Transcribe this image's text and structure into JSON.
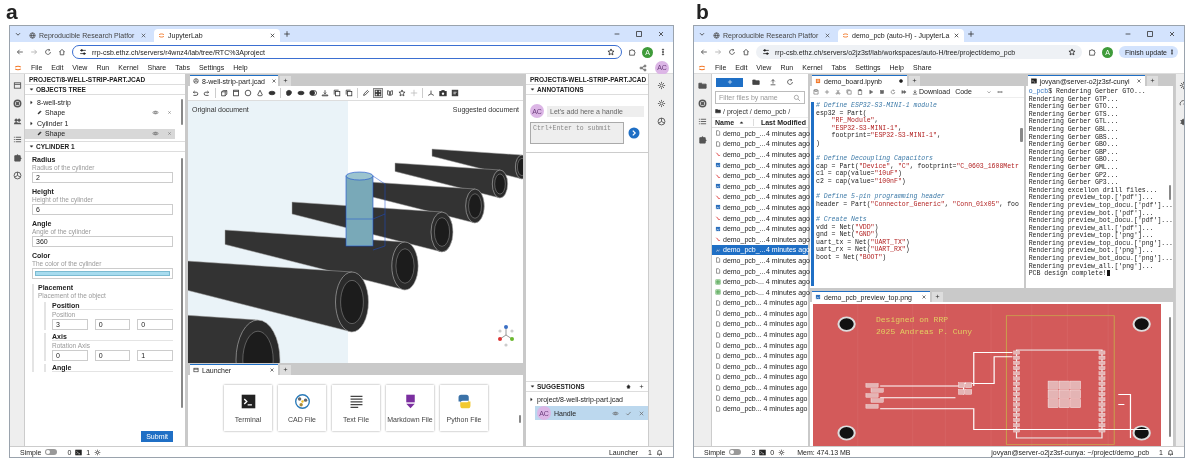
{
  "panel_a": {
    "label": "a",
    "browser": {
      "tabs": [
        {
          "title": "Reproducible Research Platfor",
          "selected": false
        },
        {
          "title": "JupyterLab",
          "selected": true
        }
      ],
      "url": "rrp-csb.ethz.ch/servers/r4wnz4/lab/tree/RTC%3Aproject",
      "url_focused": true,
      "profile": "A"
    },
    "menu": [
      "File",
      "Edit",
      "View",
      "Run",
      "Kernel",
      "Share",
      "Tabs",
      "Settings",
      "Help"
    ],
    "user_badge": "AC",
    "left_panel": {
      "title": "PROJECT/8-WELL-STRIP-PART.JCAD",
      "tree_section": "OBJECTS TREE",
      "tree": [
        {
          "label": "8-well-strip",
          "kind": "group",
          "selected": false
        },
        {
          "label": "Shape",
          "kind": "shape",
          "selected": false
        },
        {
          "label": "Cylinder 1",
          "kind": "group",
          "selected": false
        },
        {
          "label": "Shape",
          "kind": "shape",
          "selected": true
        }
      ],
      "form_section": "CYLINDER 1",
      "fields": [
        {
          "kind": "text",
          "label": "Radius",
          "description": "Radius of the cylinder",
          "value": "2"
        },
        {
          "kind": "text",
          "label": "Height",
          "description": "Height of the cylinder",
          "value": "6"
        },
        {
          "kind": "text",
          "label": "Angle",
          "description": "Angle of the cylinder",
          "value": "360"
        },
        {
          "kind": "color",
          "label": "Color",
          "description": "The color of the cylinder",
          "color": "#a8dcef"
        }
      ],
      "placement": {
        "label": "Placement",
        "description": "Placement of the object",
        "groups": [
          {
            "label": "Position",
            "description": "Position",
            "values": [
              "3",
              "0",
              "0"
            ]
          },
          {
            "label": "Axis",
            "description": "Rotation Axis",
            "values": [
              "0",
              "0",
              "1"
            ]
          },
          {
            "label": "Angle"
          }
        ]
      },
      "submit": "Submit"
    },
    "document": {
      "tab": "8-well-strip-part.jcad",
      "original_label": "Original document",
      "suggested_label": "Suggested document"
    },
    "launcher": {
      "tab": "Launcher",
      "items": [
        {
          "label": "Terminal",
          "kind": "terminal"
        },
        {
          "label": "CAD File",
          "kind": "cad"
        },
        {
          "label": "Text File",
          "kind": "text"
        },
        {
          "label": "Markdown File",
          "kind": "markdown"
        },
        {
          "label": "Python File",
          "kind": "python"
        }
      ]
    },
    "right_panel": {
      "title": "PROJECT/8-WELL-STRIP-PART.JCAD",
      "annotations_section": "ANNOTATIONS",
      "comment": {
        "author": "AC",
        "text": "Let's add here a handle"
      },
      "reply_placeholder": "Ctrl+Enter to submit",
      "suggestions_section": "SUGGESTIONS",
      "suggestions": [
        {
          "label": "project/8-well-strip-part.jcad",
          "children": [
            {
              "author": "AC",
              "label": "Handle",
              "selected": true
            }
          ]
        }
      ]
    },
    "status_bar": {
      "mode": "Simple",
      "simple_on": false,
      "terminals": "0",
      "kernels": "1",
      "right_text": "Launcher",
      "notifications": "1"
    }
  },
  "panel_b": {
    "label": "b",
    "browser": {
      "tabs": [
        {
          "title": "Reproducible Research Platfor",
          "selected": false
        },
        {
          "title": "demo_pcb (auto-H) - JupyterLa",
          "selected": true
        }
      ],
      "url": "rrp-csb.ethz.ch/servers/o2jz3sf/lab/workspaces/auto-H/tree/project/demo_pcb",
      "url_focused": false,
      "profile": "A",
      "update_button": "Finish update"
    },
    "menu": [
      "File",
      "Edit",
      "View",
      "Run",
      "Kernel",
      "Tabs",
      "Settings",
      "Help",
      "Share"
    ],
    "file_browser": {
      "filter_placeholder": "Filter files by name",
      "breadcrumb": "/ project / demo_pcb /",
      "name_header": "Name",
      "modified_header": "Last Modified",
      "files": [
        {
          "name": "demo_pcb_...",
          "kind": "file",
          "modified": "4 minutes ago",
          "selected": false
        },
        {
          "name": "demo_pcb_...",
          "kind": "file",
          "modified": "4 minutes ago",
          "selected": false
        },
        {
          "name": "demo_pcb_...",
          "kind": "pdf",
          "modified": "4 minutes ago",
          "selected": false
        },
        {
          "name": "demo_pcb_...",
          "kind": "image",
          "modified": "4 minutes ago",
          "selected": false
        },
        {
          "name": "demo_pcb_...",
          "kind": "pdf",
          "modified": "4 minutes ago",
          "selected": false
        },
        {
          "name": "demo_pcb_...",
          "kind": "image",
          "modified": "4 minutes ago",
          "selected": false
        },
        {
          "name": "demo_pcb_...",
          "kind": "pdf",
          "modified": "4 minutes ago",
          "selected": false
        },
        {
          "name": "demo_pcb_...",
          "kind": "image",
          "modified": "4 minutes ago",
          "selected": false
        },
        {
          "name": "demo_pcb_...",
          "kind": "pdf",
          "modified": "4 minutes ago",
          "selected": false
        },
        {
          "name": "demo_pcb_...",
          "kind": "image",
          "modified": "4 minutes ago",
          "selected": false
        },
        {
          "name": "demo_pcb_...",
          "kind": "pdf",
          "modified": "4 minutes ago",
          "selected": false
        },
        {
          "name": "demo_pcb_...",
          "kind": "image",
          "modified": "4 minutes ago",
          "selected": true
        },
        {
          "name": "demo_pcb_...",
          "kind": "file",
          "modified": "4 minutes ago",
          "selected": false
        },
        {
          "name": "demo_pcb_...",
          "kind": "file",
          "modified": "4 minutes ago",
          "selected": false
        },
        {
          "name": "demo_pcb-...",
          "kind": "table",
          "modified": "4 minutes ago",
          "selected": false
        },
        {
          "name": "demo_pcb-...",
          "kind": "table",
          "modified": "4 minutes ago",
          "selected": false
        },
        {
          "name": "demo_pcb...",
          "kind": "file",
          "modified": "4 minutes ago",
          "selected": false
        },
        {
          "name": "demo_pcb...",
          "kind": "file",
          "modified": "4 minutes ago",
          "selected": false
        },
        {
          "name": "demo_pcb...",
          "kind": "file",
          "modified": "4 minutes ago",
          "selected": false
        },
        {
          "name": "demo_pcb...",
          "kind": "file",
          "modified": "4 minutes ago",
          "selected": false
        },
        {
          "name": "demo_pcb...",
          "kind": "file",
          "modified": "4 minutes ago",
          "selected": false
        },
        {
          "name": "demo_pcb...",
          "kind": "file",
          "modified": "4 minutes ago",
          "selected": false
        },
        {
          "name": "demo_pcb...",
          "kind": "file",
          "modified": "4 minutes ago",
          "selected": false
        },
        {
          "name": "demo_pcb...",
          "kind": "file",
          "modified": "4 minutes ago",
          "selected": false
        },
        {
          "name": "demo_pcb...",
          "kind": "file",
          "modified": "4 minutes ago",
          "selected": false
        },
        {
          "name": "demo_pcb...",
          "kind": "file",
          "modified": "4 minutes ago",
          "selected": false
        },
        {
          "name": "demo_pcb...",
          "kind": "file",
          "modified": "4 minutes ago",
          "selected": false
        }
      ]
    },
    "notebook": {
      "tab": "demo_board.ipynb",
      "unsaved": true,
      "download": "Download",
      "cell_type": "Code",
      "lines": [
        {
          "parts": [
            {
              "kind": "comment",
              "text": "# Define ESP32-S3-MINI-1 module"
            }
          ]
        },
        {
          "parts": [
            {
              "kind": "plain",
              "text": "esp32 = Part("
            }
          ]
        },
        {
          "parts": [
            {
              "kind": "string",
              "text": "    \"RF_Module\""
            },
            {
              "kind": "plain",
              "text": ","
            }
          ]
        },
        {
          "parts": [
            {
              "kind": "string",
              "text": "    \"ESP32-S3-MINI-1\""
            },
            {
              "kind": "plain",
              "text": ","
            }
          ]
        },
        {
          "parts": [
            {
              "kind": "plain",
              "text": "    footprint="
            },
            {
              "kind": "string",
              "text": "\"ESP32-S3-MINI-1\""
            },
            {
              "kind": "plain",
              "text": ","
            }
          ]
        },
        {
          "parts": [
            {
              "kind": "plain",
              "text": ")"
            }
          ]
        },
        {
          "gap": true,
          "parts": [
            {
              "kind": "comment",
              "text": "# Define Decoupling Capacitors"
            }
          ]
        },
        {
          "parts": [
            {
              "kind": "plain",
              "text": "cap = Part("
            },
            {
              "kind": "string",
              "text": "\"Device\""
            },
            {
              "kind": "plain",
              "text": ", "
            },
            {
              "kind": "string",
              "text": "\"C\""
            },
            {
              "kind": "plain",
              "text": ", footprint="
            },
            {
              "kind": "string",
              "text": "\"C_0603_1608Metr"
            }
          ]
        },
        {
          "parts": [
            {
              "kind": "plain",
              "text": "c1 = cap(value="
            },
            {
              "kind": "string",
              "text": "\"10uF\""
            },
            {
              "kind": "plain",
              "text": ")"
            }
          ]
        },
        {
          "parts": [
            {
              "kind": "plain",
              "text": "c2 = cap(value="
            },
            {
              "kind": "string",
              "text": "\"100nF\""
            },
            {
              "kind": "plain",
              "text": ")"
            }
          ]
        },
        {
          "gap": true,
          "parts": [
            {
              "kind": "comment",
              "text": "# Define 5-pin programming header"
            }
          ]
        },
        {
          "parts": [
            {
              "kind": "plain",
              "text": "header = Part("
            },
            {
              "kind": "string",
              "text": "\"Connector_Generic\""
            },
            {
              "kind": "plain",
              "text": ", "
            },
            {
              "kind": "string",
              "text": "\"Conn_01x05\""
            },
            {
              "kind": "plain",
              "text": ", foo"
            }
          ]
        },
        {
          "gap": true,
          "parts": [
            {
              "kind": "comment",
              "text": "# Create Nets"
            }
          ]
        },
        {
          "parts": [
            {
              "kind": "plain",
              "text": "vdd = Net("
            },
            {
              "kind": "string",
              "text": "\"VDD\""
            },
            {
              "kind": "plain",
              "text": ")"
            }
          ]
        },
        {
          "parts": [
            {
              "kind": "plain",
              "text": "gnd = Net("
            },
            {
              "kind": "string",
              "text": "\"GND\""
            },
            {
              "kind": "plain",
              "text": ")"
            }
          ]
        },
        {
          "parts": [
            {
              "kind": "plain",
              "text": "uart_tx = Net("
            },
            {
              "kind": "string",
              "text": "\"UART_TX\""
            },
            {
              "kind": "plain",
              "text": ")"
            }
          ]
        },
        {
          "parts": [
            {
              "kind": "plain",
              "text": "uart_rx = Net("
            },
            {
              "kind": "string",
              "text": "\"UART_RX\""
            },
            {
              "kind": "plain",
              "text": ")"
            }
          ]
        },
        {
          "parts": [
            {
              "kind": "plain",
              "text": "boot = Net("
            },
            {
              "kind": "string",
              "text": "\"BOOT\""
            },
            {
              "kind": "plain",
              "text": ")"
            }
          ]
        }
      ]
    },
    "terminal": {
      "tab": "jovyan@server-o2jz3sf-cunyi",
      "lines": [
        {
          "parts": [
            {
              "kind": "prompt",
              "text": "o_pcb"
            },
            {
              "kind": "plain",
              "text": "$ Rendering Gerber GTO..."
            }
          ]
        },
        {
          "parts": [
            {
              "kind": "plain",
              "text": "Rendering Gerber GTP..."
            }
          ]
        },
        {
          "parts": [
            {
              "kind": "plain",
              "text": "Rendering Gerber GTO..."
            }
          ]
        },
        {
          "parts": [
            {
              "kind": "plain",
              "text": "Rendering Gerber GTS..."
            }
          ]
        },
        {
          "parts": [
            {
              "kind": "plain",
              "text": "Rendering Gerber GTL..."
            }
          ]
        },
        {
          "parts": [
            {
              "kind": "plain",
              "text": "Rendering Gerber GBL..."
            }
          ]
        },
        {
          "parts": [
            {
              "kind": "plain",
              "text": "Rendering Gerber GBS..."
            }
          ]
        },
        {
          "parts": [
            {
              "kind": "plain",
              "text": "Rendering Gerber GBO..."
            }
          ]
        },
        {
          "parts": [
            {
              "kind": "plain",
              "text": "Rendering Gerber GBP..."
            }
          ]
        },
        {
          "parts": [
            {
              "kind": "plain",
              "text": "Rendering Gerber GBO..."
            }
          ]
        },
        {
          "parts": [
            {
              "kind": "plain",
              "text": "Rendering Gerber GML..."
            }
          ]
        },
        {
          "parts": [
            {
              "kind": "plain",
              "text": "Rendering Gerber GP2..."
            }
          ]
        },
        {
          "parts": [
            {
              "kind": "plain",
              "text": "Rendering Gerber GP3..."
            }
          ]
        },
        {
          "parts": [
            {
              "kind": "plain",
              "text": "Rendering excellon drill files..."
            }
          ]
        },
        {
          "parts": [
            {
              "kind": "plain",
              "text": "Rendering preview_top.['pdf']..."
            }
          ]
        },
        {
          "parts": [
            {
              "kind": "plain",
              "text": "Rendering preview_top_docu.['pdf']..."
            }
          ]
        },
        {
          "parts": [
            {
              "kind": "plain",
              "text": "Rendering preview_bot.['pdf']..."
            }
          ]
        },
        {
          "parts": [
            {
              "kind": "plain",
              "text": "Rendering preview_bot_docu.['pdf']..."
            }
          ]
        },
        {
          "parts": [
            {
              "kind": "plain",
              "text": "Rendering preview_all.['pdf']..."
            }
          ]
        },
        {
          "parts": [
            {
              "kind": "plain",
              "text": "Rendering preview_top.['png']..."
            }
          ]
        },
        {
          "parts": [
            {
              "kind": "plain",
              "text": "Rendering preview_top_docu.['png']..."
            }
          ]
        },
        {
          "parts": [
            {
              "kind": "plain",
              "text": "Rendering preview_bot.['png']..."
            }
          ]
        },
        {
          "parts": [
            {
              "kind": "plain",
              "text": "Rendering preview_bot_docu.['png']..."
            }
          ]
        },
        {
          "parts": [
            {
              "kind": "plain",
              "text": "Rendering preview_all.['png']..."
            }
          ]
        },
        {
          "parts": [
            {
              "kind": "plain",
              "text": "PCB design complete!"
            }
          ],
          "cursor": true
        }
      ]
    },
    "image_viewer": {
      "tab": "demo_pcb_preview_top.png",
      "silkscreen": [
        "Designed on RRP",
        "2025 Andreas P. Cuny"
      ]
    },
    "status_bar": {
      "mode": "Simple",
      "simple_on": false,
      "terminals": "3",
      "kernels": "0",
      "memory": "Mem: 474.13 MB",
      "right_text": "jovyan@server-o2jz3sf-cunya: ~/project/demo_pcb",
      "notifications": "1"
    }
  }
}
